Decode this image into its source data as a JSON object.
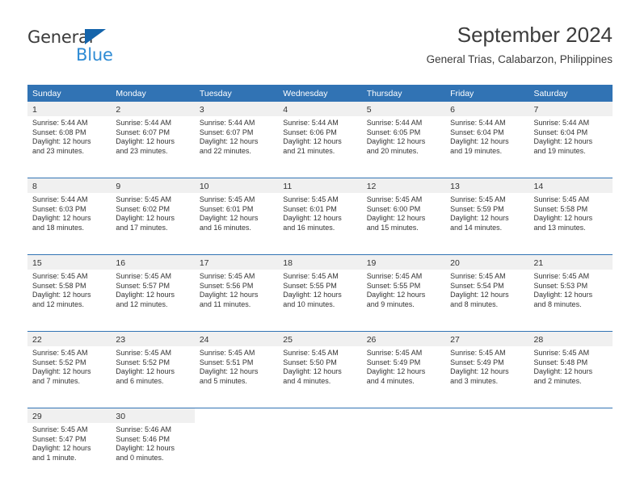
{
  "brand": {
    "name_part1": "General",
    "name_part2": "Blue",
    "triangle_color": "#1464ab",
    "blue_color": "#2e8bd4"
  },
  "header": {
    "title": "September 2024",
    "subtitle": "General Trias, Calabarzon, Philippines"
  },
  "theme": {
    "header_blue": "#3173b4",
    "daynum_gray": "#f0f0f0",
    "text": "#333333"
  },
  "calendar": {
    "weekday_headers": [
      "Sunday",
      "Monday",
      "Tuesday",
      "Wednesday",
      "Thursday",
      "Friday",
      "Saturday"
    ],
    "weeks": [
      {
        "days": [
          {
            "num": "1",
            "sunrise": "Sunrise: 5:44 AM",
            "sunset": "Sunset: 6:08 PM",
            "daylight1": "Daylight: 12 hours",
            "daylight2": "and 23 minutes."
          },
          {
            "num": "2",
            "sunrise": "Sunrise: 5:44 AM",
            "sunset": "Sunset: 6:07 PM",
            "daylight1": "Daylight: 12 hours",
            "daylight2": "and 23 minutes."
          },
          {
            "num": "3",
            "sunrise": "Sunrise: 5:44 AM",
            "sunset": "Sunset: 6:07 PM",
            "daylight1": "Daylight: 12 hours",
            "daylight2": "and 22 minutes."
          },
          {
            "num": "4",
            "sunrise": "Sunrise: 5:44 AM",
            "sunset": "Sunset: 6:06 PM",
            "daylight1": "Daylight: 12 hours",
            "daylight2": "and 21 minutes."
          },
          {
            "num": "5",
            "sunrise": "Sunrise: 5:44 AM",
            "sunset": "Sunset: 6:05 PM",
            "daylight1": "Daylight: 12 hours",
            "daylight2": "and 20 minutes."
          },
          {
            "num": "6",
            "sunrise": "Sunrise: 5:44 AM",
            "sunset": "Sunset: 6:04 PM",
            "daylight1": "Daylight: 12 hours",
            "daylight2": "and 19 minutes."
          },
          {
            "num": "7",
            "sunrise": "Sunrise: 5:44 AM",
            "sunset": "Sunset: 6:04 PM",
            "daylight1": "Daylight: 12 hours",
            "daylight2": "and 19 minutes."
          }
        ]
      },
      {
        "days": [
          {
            "num": "8",
            "sunrise": "Sunrise: 5:44 AM",
            "sunset": "Sunset: 6:03 PM",
            "daylight1": "Daylight: 12 hours",
            "daylight2": "and 18 minutes."
          },
          {
            "num": "9",
            "sunrise": "Sunrise: 5:45 AM",
            "sunset": "Sunset: 6:02 PM",
            "daylight1": "Daylight: 12 hours",
            "daylight2": "and 17 minutes."
          },
          {
            "num": "10",
            "sunrise": "Sunrise: 5:45 AM",
            "sunset": "Sunset: 6:01 PM",
            "daylight1": "Daylight: 12 hours",
            "daylight2": "and 16 minutes."
          },
          {
            "num": "11",
            "sunrise": "Sunrise: 5:45 AM",
            "sunset": "Sunset: 6:01 PM",
            "daylight1": "Daylight: 12 hours",
            "daylight2": "and 16 minutes."
          },
          {
            "num": "12",
            "sunrise": "Sunrise: 5:45 AM",
            "sunset": "Sunset: 6:00 PM",
            "daylight1": "Daylight: 12 hours",
            "daylight2": "and 15 minutes."
          },
          {
            "num": "13",
            "sunrise": "Sunrise: 5:45 AM",
            "sunset": "Sunset: 5:59 PM",
            "daylight1": "Daylight: 12 hours",
            "daylight2": "and 14 minutes."
          },
          {
            "num": "14",
            "sunrise": "Sunrise: 5:45 AM",
            "sunset": "Sunset: 5:58 PM",
            "daylight1": "Daylight: 12 hours",
            "daylight2": "and 13 minutes."
          }
        ]
      },
      {
        "days": [
          {
            "num": "15",
            "sunrise": "Sunrise: 5:45 AM",
            "sunset": "Sunset: 5:58 PM",
            "daylight1": "Daylight: 12 hours",
            "daylight2": "and 12 minutes."
          },
          {
            "num": "16",
            "sunrise": "Sunrise: 5:45 AM",
            "sunset": "Sunset: 5:57 PM",
            "daylight1": "Daylight: 12 hours",
            "daylight2": "and 12 minutes."
          },
          {
            "num": "17",
            "sunrise": "Sunrise: 5:45 AM",
            "sunset": "Sunset: 5:56 PM",
            "daylight1": "Daylight: 12 hours",
            "daylight2": "and 11 minutes."
          },
          {
            "num": "18",
            "sunrise": "Sunrise: 5:45 AM",
            "sunset": "Sunset: 5:55 PM",
            "daylight1": "Daylight: 12 hours",
            "daylight2": "and 10 minutes."
          },
          {
            "num": "19",
            "sunrise": "Sunrise: 5:45 AM",
            "sunset": "Sunset: 5:55 PM",
            "daylight1": "Daylight: 12 hours",
            "daylight2": "and 9 minutes."
          },
          {
            "num": "20",
            "sunrise": "Sunrise: 5:45 AM",
            "sunset": "Sunset: 5:54 PM",
            "daylight1": "Daylight: 12 hours",
            "daylight2": "and 8 minutes."
          },
          {
            "num": "21",
            "sunrise": "Sunrise: 5:45 AM",
            "sunset": "Sunset: 5:53 PM",
            "daylight1": "Daylight: 12 hours",
            "daylight2": "and 8 minutes."
          }
        ]
      },
      {
        "days": [
          {
            "num": "22",
            "sunrise": "Sunrise: 5:45 AM",
            "sunset": "Sunset: 5:52 PM",
            "daylight1": "Daylight: 12 hours",
            "daylight2": "and 7 minutes."
          },
          {
            "num": "23",
            "sunrise": "Sunrise: 5:45 AM",
            "sunset": "Sunset: 5:52 PM",
            "daylight1": "Daylight: 12 hours",
            "daylight2": "and 6 minutes."
          },
          {
            "num": "24",
            "sunrise": "Sunrise: 5:45 AM",
            "sunset": "Sunset: 5:51 PM",
            "daylight1": "Daylight: 12 hours",
            "daylight2": "and 5 minutes."
          },
          {
            "num": "25",
            "sunrise": "Sunrise: 5:45 AM",
            "sunset": "Sunset: 5:50 PM",
            "daylight1": "Daylight: 12 hours",
            "daylight2": "and 4 minutes."
          },
          {
            "num": "26",
            "sunrise": "Sunrise: 5:45 AM",
            "sunset": "Sunset: 5:49 PM",
            "daylight1": "Daylight: 12 hours",
            "daylight2": "and 4 minutes."
          },
          {
            "num": "27",
            "sunrise": "Sunrise: 5:45 AM",
            "sunset": "Sunset: 5:49 PM",
            "daylight1": "Daylight: 12 hours",
            "daylight2": "and 3 minutes."
          },
          {
            "num": "28",
            "sunrise": "Sunrise: 5:45 AM",
            "sunset": "Sunset: 5:48 PM",
            "daylight1": "Daylight: 12 hours",
            "daylight2": "and 2 minutes."
          }
        ]
      },
      {
        "days": [
          {
            "num": "29",
            "sunrise": "Sunrise: 5:45 AM",
            "sunset": "Sunset: 5:47 PM",
            "daylight1": "Daylight: 12 hours",
            "daylight2": "and 1 minute."
          },
          {
            "num": "30",
            "sunrise": "Sunrise: 5:46 AM",
            "sunset": "Sunset: 5:46 PM",
            "daylight1": "Daylight: 12 hours",
            "daylight2": "and 0 minutes."
          },
          {
            "num": "",
            "sunrise": "",
            "sunset": "",
            "daylight1": "",
            "daylight2": ""
          },
          {
            "num": "",
            "sunrise": "",
            "sunset": "",
            "daylight1": "",
            "daylight2": ""
          },
          {
            "num": "",
            "sunrise": "",
            "sunset": "",
            "daylight1": "",
            "daylight2": ""
          },
          {
            "num": "",
            "sunrise": "",
            "sunset": "",
            "daylight1": "",
            "daylight2": ""
          },
          {
            "num": "",
            "sunrise": "",
            "sunset": "",
            "daylight1": "",
            "daylight2": ""
          }
        ]
      }
    ]
  }
}
